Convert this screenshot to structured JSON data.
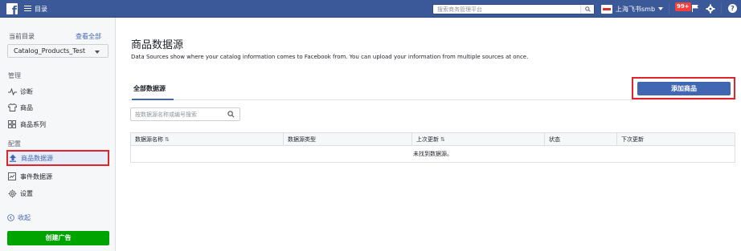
{
  "topbar": {
    "menu_label": "目录",
    "search_placeholder": "搜索商务管理平台",
    "account_name": "上海飞书smb",
    "notif_count": "99+",
    "help_label": "?"
  },
  "sidebar": {
    "catalog_label": "当前目录",
    "view_all": "查看全部",
    "catalog_selected": "Catalog_Products_Test",
    "section_manage": "管理",
    "nav_diagnostics": "诊断",
    "nav_products": "商品",
    "nav_product_sets": "商品系列",
    "section_config": "配置",
    "nav_product_sources": "商品数据源",
    "nav_event_sources": "事件数据源",
    "nav_settings": "设置",
    "collapse": "收起",
    "create_ad": "创建广告"
  },
  "main": {
    "title": "商品数据源",
    "description": "Data Sources show where your catalog information comes to Facebook from. You can upload your information from multiple sources at once.",
    "tab_all": "全部数据源",
    "add_product": "添加商品",
    "filter_placeholder": "按数据源名称或编号搜索",
    "columns": [
      "数据源名称",
      "数据源类型",
      "上次更新",
      "状态",
      "下次更新"
    ],
    "sort_symbol": "⇅",
    "empty_message": "未找到数据源。"
  },
  "colors": {
    "topbar": "#3b5998",
    "primary": "#4267b2",
    "create_ad": "#00a400",
    "highlight": "#e0242b"
  },
  "icons": [
    "facebook-logo-icon",
    "hamburger-icon",
    "search-icon",
    "caret-down-icon",
    "flag-icon",
    "gear-icon",
    "help-icon",
    "pulse-icon",
    "shirt-icon",
    "grid-icon",
    "upload-icon",
    "event-icon",
    "settings-icon",
    "collapse-icon"
  ]
}
